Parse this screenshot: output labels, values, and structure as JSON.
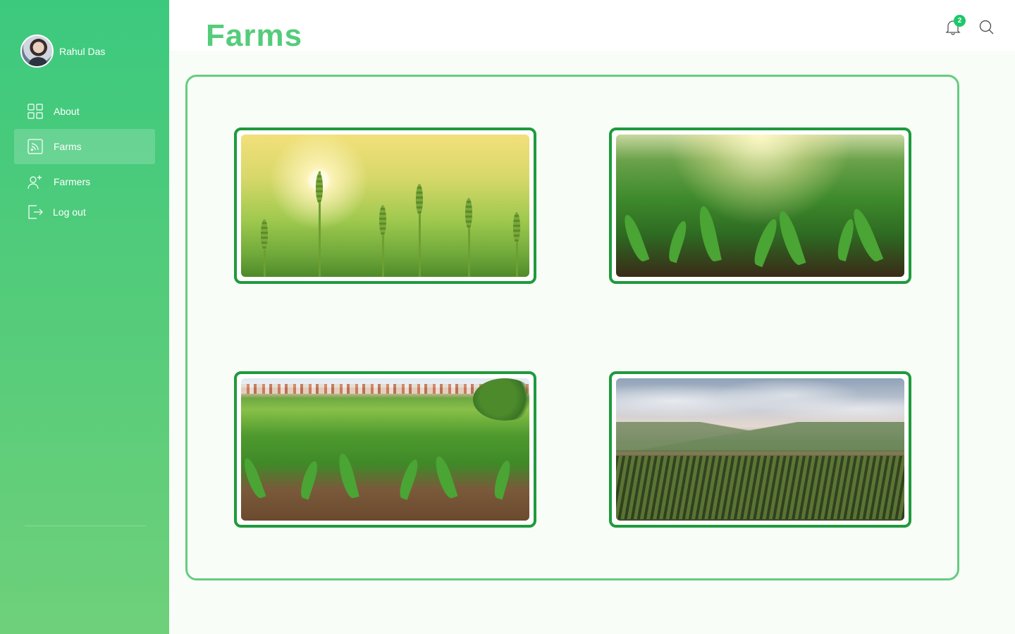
{
  "sidebar": {
    "user_name": "Rahul Das",
    "items": [
      {
        "label": "About",
        "icon": "grid-icon"
      },
      {
        "label": "Farms",
        "icon": "rss-icon"
      },
      {
        "label": "Farmers",
        "icon": "add-user-icon"
      },
      {
        "label": "Log out",
        "icon": "logout-icon"
      }
    ],
    "active_item": "Farms"
  },
  "header": {
    "title": "Farms",
    "notification_count": "2"
  },
  "farms": [
    {
      "image": "wheat-field-sunrise"
    },
    {
      "image": "corn-field-sunlight"
    },
    {
      "image": "young-corn-field-village"
    },
    {
      "image": "crop-rows-mountains"
    }
  ],
  "colors": {
    "accent": "#55cc7a",
    "card_border": "#1f9a3c",
    "badge": "#1fc769",
    "panel_border": "#66cc80"
  }
}
